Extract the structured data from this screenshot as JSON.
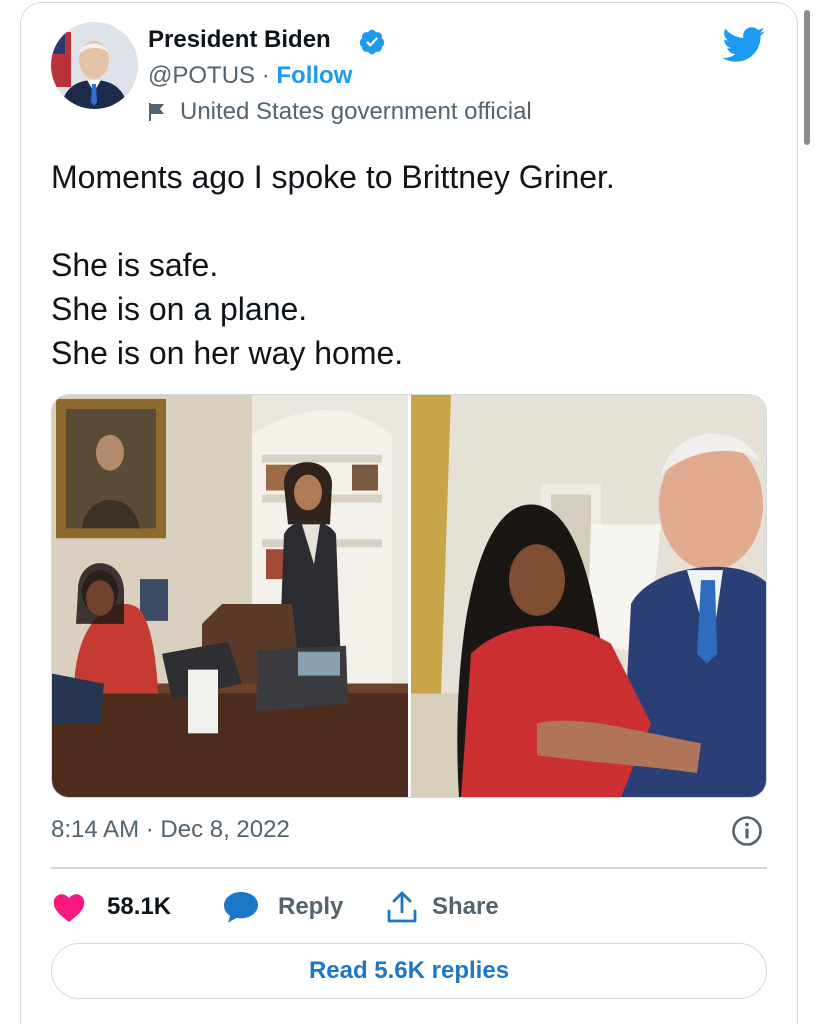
{
  "author": {
    "display_name": "President Biden",
    "handle": "@POTUS",
    "separator": "·",
    "follow_label": "Follow",
    "label": "United States government official"
  },
  "tweet": {
    "lines": [
      "Moments ago I spoke to Brittney Griner.",
      "She is safe.",
      "She is on a plane.",
      "She is on her way home."
    ],
    "timestamp": "8:14 AM · Dec 8, 2022"
  },
  "actions": {
    "like_count": "58.1K",
    "reply_label": "Reply",
    "share_label": "Share",
    "read_replies_label": "Read 5.6K replies"
  },
  "icons": {
    "verified": "verified-badge-icon",
    "bird": "twitter-bird-icon",
    "flag": "flag-icon",
    "info": "info-icon",
    "like": "heart-icon",
    "reply": "speech-bubble-icon",
    "share": "share-arrow-icon"
  },
  "colors": {
    "accent": "#1d9bf0",
    "link": "#1d77c9",
    "like": "#f91880",
    "text": "#0f1419",
    "muted": "#536471",
    "border": "#cfd9de"
  }
}
